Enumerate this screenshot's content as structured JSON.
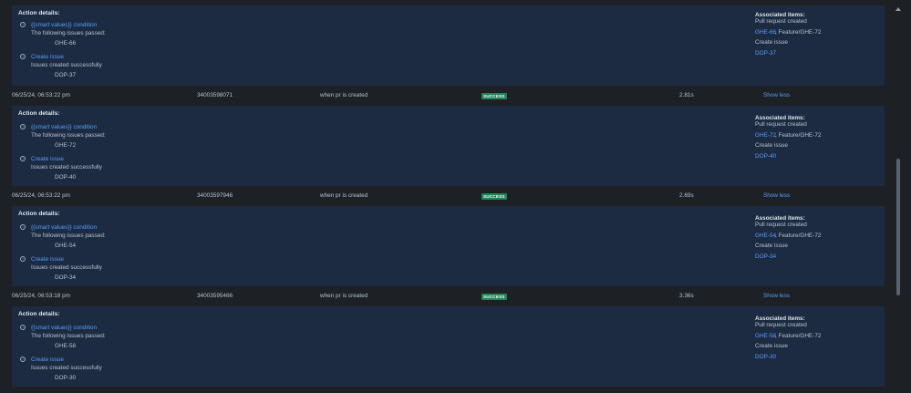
{
  "labels": {
    "action_details": "Action details:",
    "associated_items": "Associated items:",
    "following_issues_passed": "The following issues passed:",
    "issues_created": "Issues created successfully",
    "smart_values_condition": "{{smart values}} condition",
    "create_issue": "Create issue",
    "pull_request_created": "Pull request created",
    "create_issue_plain": "Create issue",
    "show_less": "Show less",
    "info_glyph": "i"
  },
  "panels": [
    {
      "passed_issue": "GHE-66",
      "created_issue": "DOP-37",
      "pr_issue": "GHE-66",
      "pr_branch": ", Feature/GHE-72"
    },
    {
      "passed_issue": "GHE-72",
      "created_issue": "DOP-40",
      "pr_issue": "GHE-72",
      "pr_branch": ", Feature/GHE-72"
    },
    {
      "passed_issue": "GHE-54",
      "created_issue": "DOP-34",
      "pr_issue": "GHE-54",
      "pr_branch": ", Feature/GHE-72"
    },
    {
      "passed_issue": "GHE-58",
      "created_issue": "DOP-30",
      "pr_issue": "GHE-58",
      "pr_branch": ", Feature/GHE-72"
    }
  ],
  "rows": [
    {
      "date": "06/25/24, 06:53:22 pm",
      "id": "34003598071",
      "trigger": "when pr is created",
      "status": "SUCCESS",
      "duration": "2.81s"
    },
    {
      "date": "06/25/24, 06:53:22 pm",
      "id": "34003597946",
      "trigger": "when pr is created",
      "status": "SUCCESS",
      "duration": "2.69s"
    },
    {
      "date": "06/25/24, 06:53:18 pm",
      "id": "34003595466",
      "trigger": "when pr is created",
      "status": "SUCCESS",
      "duration": "3.36s"
    }
  ]
}
